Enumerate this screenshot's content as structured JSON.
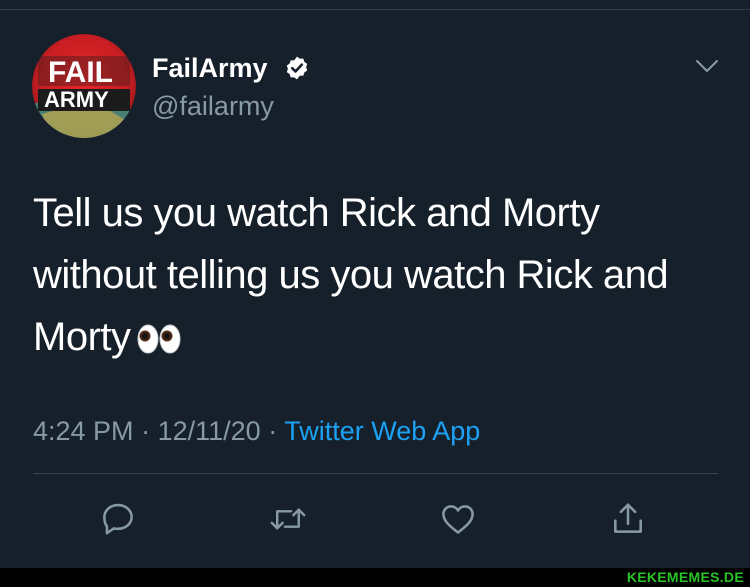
{
  "tweet": {
    "display_name": "FailArmy",
    "handle": "@failarmy",
    "text": "Tell us you watch Rick and Morty without telling us you watch Rick and Morty",
    "time": "4:24 PM",
    "date": "12/11/20",
    "source": "Twitter Web App",
    "separator": "·"
  },
  "avatar": {
    "logo_line1": "FAIL",
    "logo_line2": "ARMY"
  },
  "icons": {
    "verified": "verified-badge-icon",
    "caret": "chevron-down-icon",
    "reply": "reply-icon",
    "retweet": "retweet-icon",
    "like": "heart-icon",
    "share": "share-icon",
    "emoji": "eyes-emoji"
  },
  "colors": {
    "background": "#15202b",
    "secondary_text": "#8899a6",
    "link": "#1da1f2",
    "watermark": "#27c327"
  },
  "watermark": {
    "text": "KEKEMEMES.DE"
  }
}
